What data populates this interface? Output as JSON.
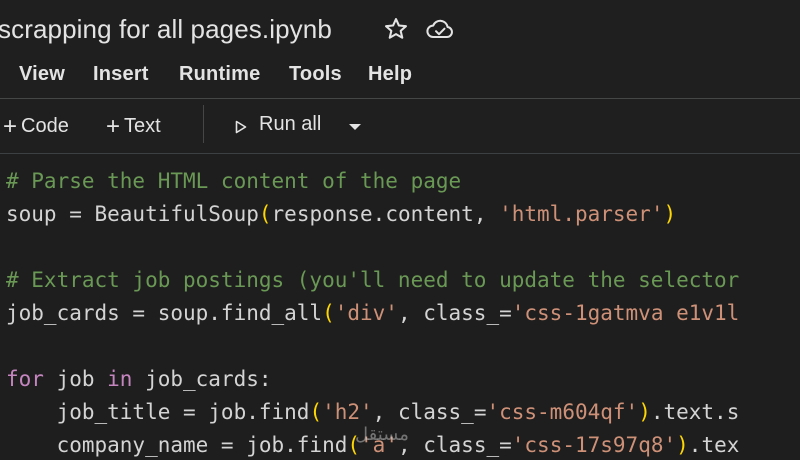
{
  "notebook": {
    "title": "scrapping for all pages.ipynb"
  },
  "menu": {
    "items": [
      "View",
      "Insert",
      "Runtime",
      "Tools",
      "Help"
    ]
  },
  "toolbar": {
    "add_code_label": "Code",
    "add_text_label": "Text",
    "run_all_label": "Run all"
  },
  "icons": {
    "star": "star-icon",
    "cloud": "cloud-icon",
    "play": "play-icon",
    "caret": "chevron-down-icon"
  },
  "colors": {
    "background": "#1e1e1e",
    "comment": "#6a9955",
    "string": "#ce9178",
    "keyword": "#c586c0",
    "paren": "#ffd700",
    "text": "#d4d4d4"
  },
  "code": {
    "lines": [
      [
        {
          "t": "comment",
          "v": "# Parse the HTML content of the page"
        }
      ],
      [
        {
          "t": "default",
          "v": "soup = BeautifulSoup"
        },
        {
          "t": "paren",
          "v": "("
        },
        {
          "t": "default",
          "v": "response.content, "
        },
        {
          "t": "string",
          "v": "'html.parser'"
        },
        {
          "t": "paren",
          "v": ")"
        }
      ],
      [],
      [
        {
          "t": "comment",
          "v": "# Extract job postings (you'll need to update the selector"
        }
      ],
      [
        {
          "t": "default",
          "v": "job_cards = soup.find_all"
        },
        {
          "t": "paren",
          "v": "("
        },
        {
          "t": "string",
          "v": "'div'"
        },
        {
          "t": "default",
          "v": ", class_="
        },
        {
          "t": "string",
          "v": "'css-1gatmva e1v1l"
        }
      ],
      [],
      [
        {
          "t": "keyword",
          "v": "for"
        },
        {
          "t": "default",
          "v": " job "
        },
        {
          "t": "keyword",
          "v": "in"
        },
        {
          "t": "default",
          "v": " job_cards:"
        }
      ],
      [
        {
          "t": "default",
          "v": "    job_title = job.find"
        },
        {
          "t": "paren",
          "v": "("
        },
        {
          "t": "string",
          "v": "'h2'"
        },
        {
          "t": "default",
          "v": ", class_="
        },
        {
          "t": "string",
          "v": "'css-m604qf'"
        },
        {
          "t": "paren",
          "v": ")"
        },
        {
          "t": "default",
          "v": ".text.s"
        }
      ],
      [
        {
          "t": "default",
          "v": "    company_name = job.find"
        },
        {
          "t": "paren",
          "v": "("
        },
        {
          "t": "string",
          "v": "'a'"
        },
        {
          "t": "default",
          "v": ", class_="
        },
        {
          "t": "string",
          "v": "'css-17s97q8'"
        },
        {
          "t": "paren",
          "v": ")"
        },
        {
          "t": "default",
          "v": ".tex"
        }
      ]
    ]
  },
  "watermark": {
    "text": "مستقل"
  }
}
